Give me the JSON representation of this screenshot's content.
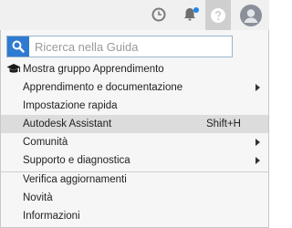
{
  "search": {
    "placeholder": "Ricerca nella Guida"
  },
  "menu": {
    "items": [
      {
        "label": "Mostra gruppo Apprendimento",
        "icon": "graduation-cap-icon"
      },
      {
        "label": "Apprendimento e documentazione",
        "submenu": true
      },
      {
        "label": "Impostazione rapida"
      },
      {
        "label": "Autodesk Assistant",
        "shortcut": "Shift+H",
        "highlighted": true
      },
      {
        "label": "Comunità",
        "submenu": true
      },
      {
        "label": "Supporto e diagnostica",
        "submenu": true
      },
      {
        "label": "Verifica aggiornamenti"
      },
      {
        "label": "Novità"
      },
      {
        "label": "Informazioni"
      }
    ]
  },
  "colors": {
    "accent": "#2e7bd1",
    "notification_dot": "#1e88e5",
    "highlight": "#dcdcdc"
  }
}
